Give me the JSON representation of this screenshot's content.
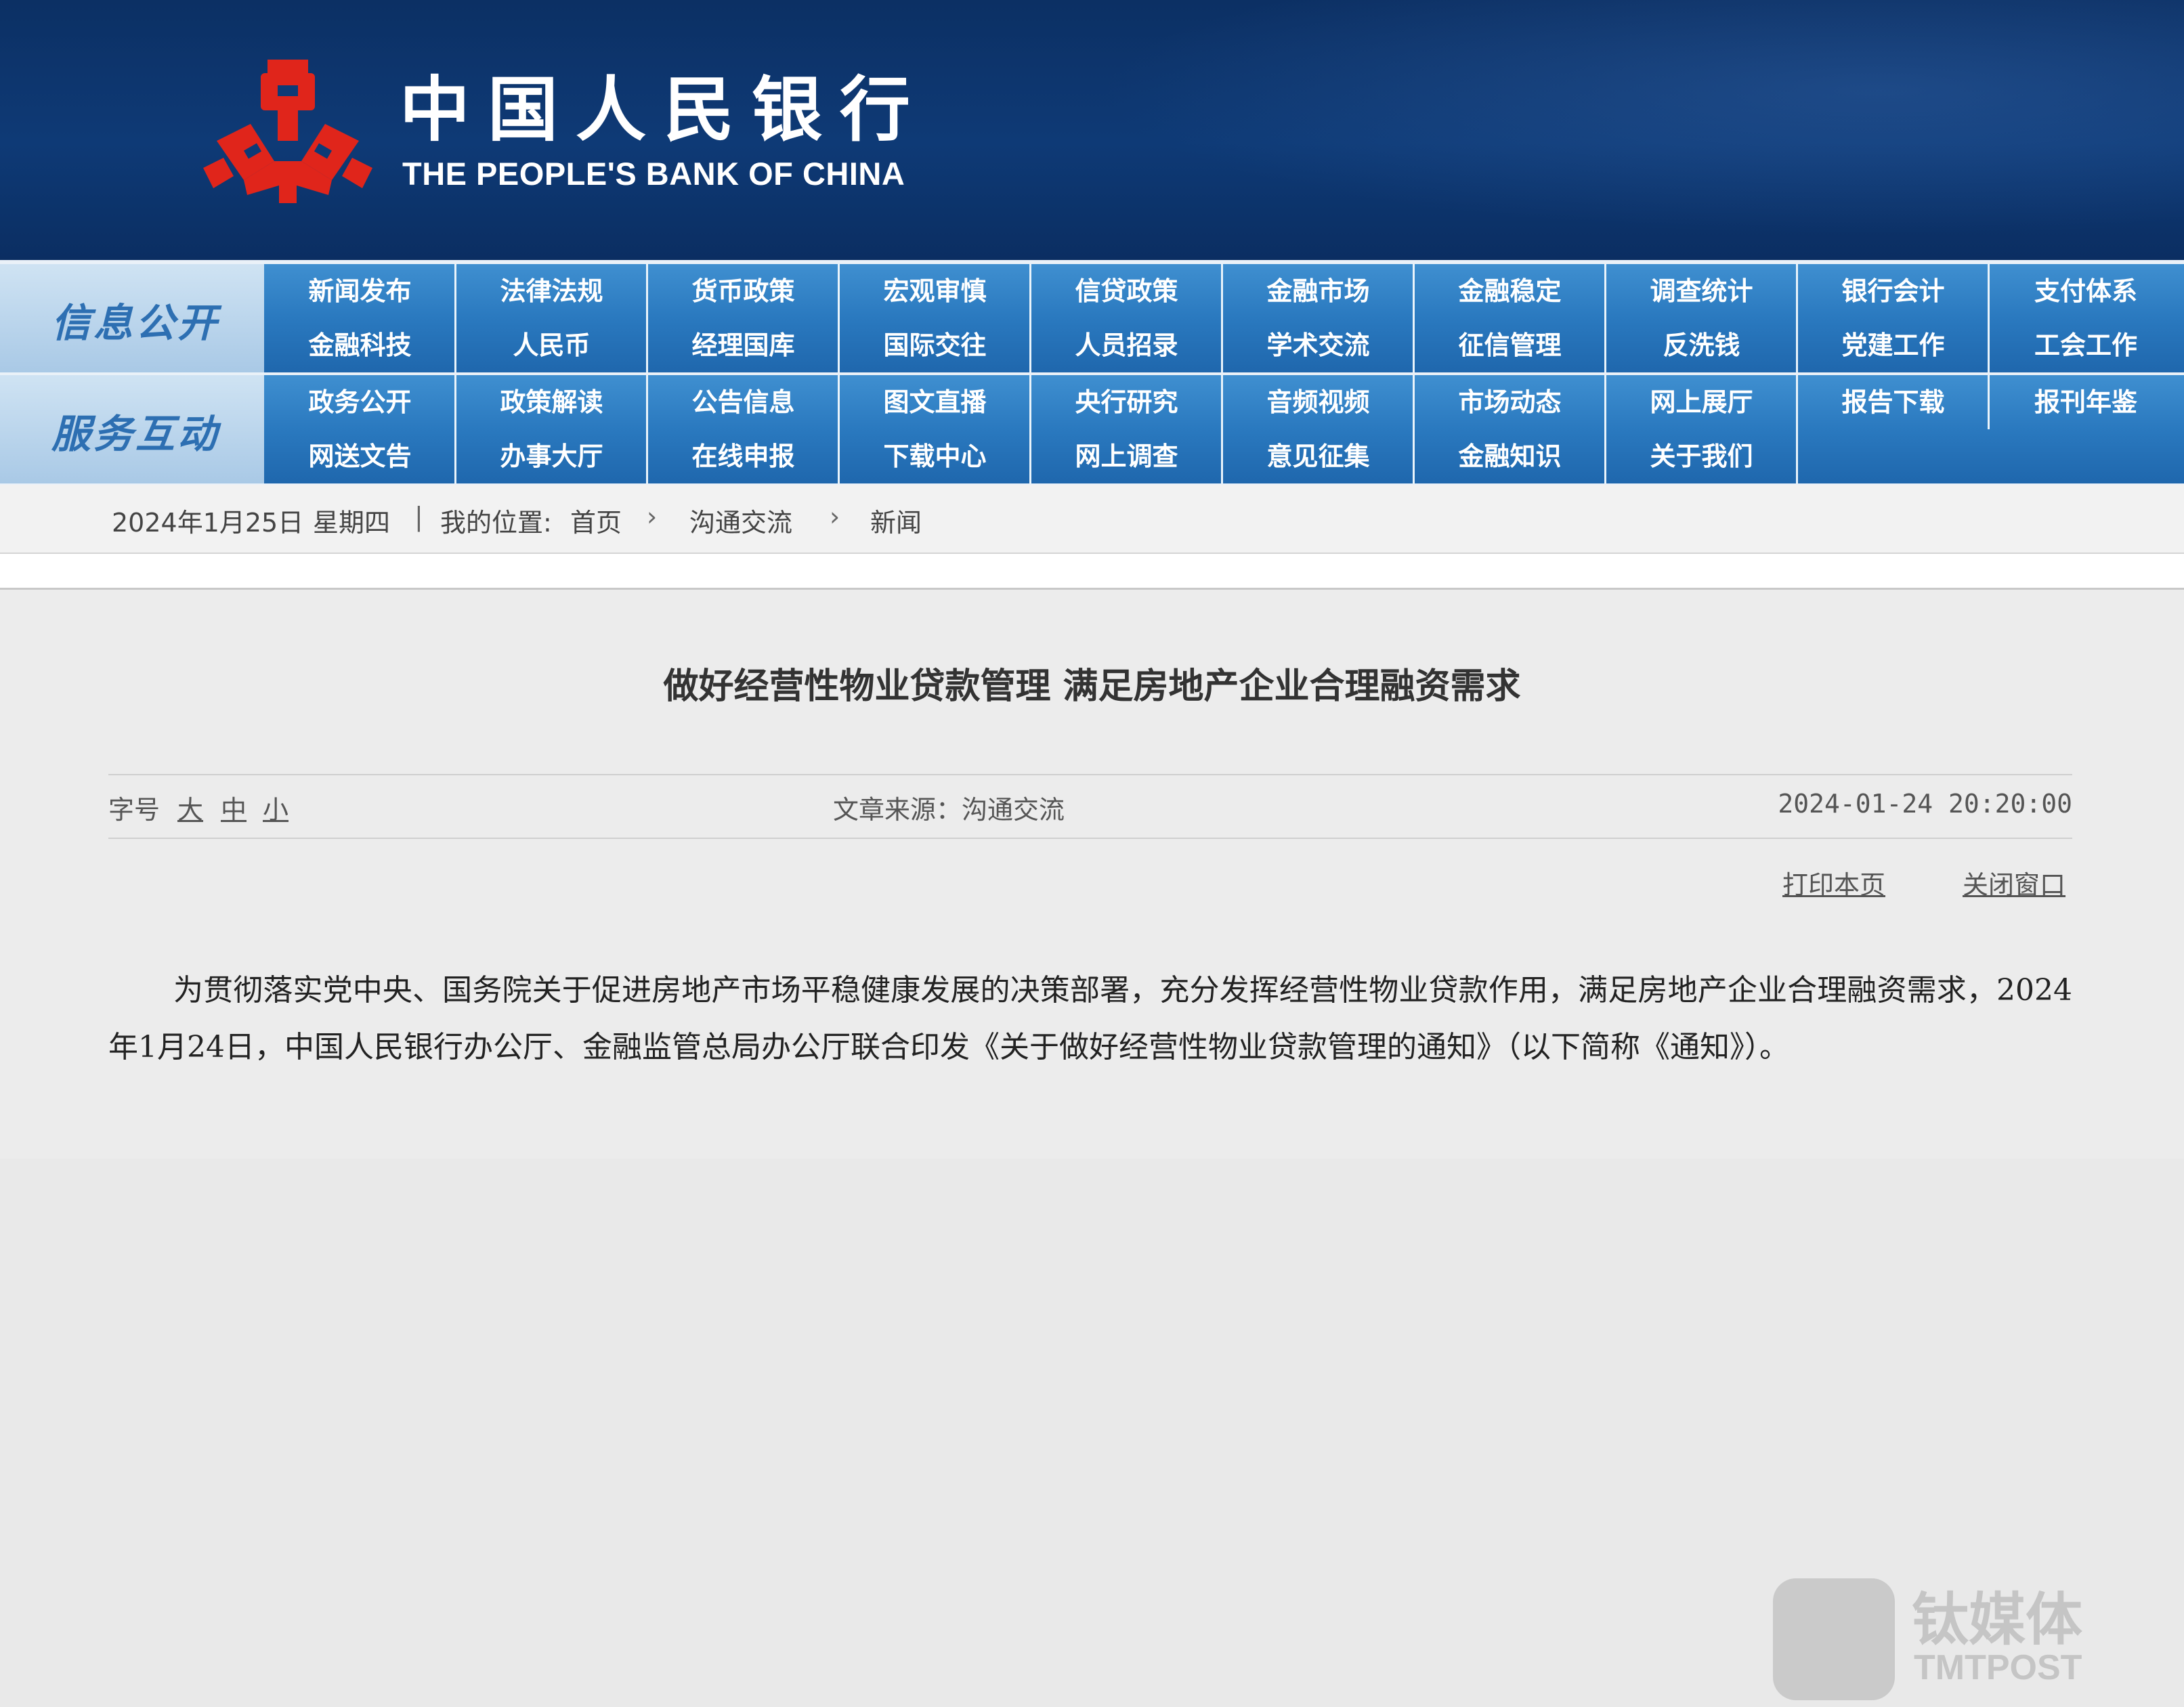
{
  "header": {
    "logo_cn": "中国人民银行",
    "logo_en": "THE PEOPLE'S BANK OF CHINA",
    "logo_icon": "pboc-emblem-icon",
    "bg_color": "#0e3a76",
    "emblem_color": "#e0251b"
  },
  "nav": {
    "band1_label": "信息公开",
    "band2_label": "服务互动",
    "band1_items": [
      "新闻发布",
      "法律法规",
      "货币政策",
      "宏观审慎",
      "信贷政策",
      "金融市场",
      "金融稳定",
      "调查统计",
      "银行会计",
      "支付体系",
      "金融科技",
      "人民币",
      "经理国库",
      "国际交往",
      "人员招录",
      "学术交流",
      "征信管理",
      "反洗钱",
      "党建工作",
      "工会工作"
    ],
    "band2_items": [
      "政务公开",
      "政策解读",
      "公告信息",
      "图文直播",
      "央行研究",
      "音频视频",
      "市场动态",
      "网上展厅",
      "报告下载",
      "报刊年鉴",
      "网送文告",
      "办事大厅",
      "在线申报",
      "下载中心",
      "网上调查",
      "意见征集",
      "金融知识",
      "关于我们"
    ]
  },
  "breadcrumb": {
    "date": "2024年1月25日",
    "weekday": "星期四",
    "divider": "|",
    "location_label": "我的位置:",
    "home": "首页",
    "section": "沟通交流",
    "page": "新闻",
    "arrow": "›"
  },
  "article": {
    "title": "做好经营性物业贷款管理 满足房地产企业合理融资需求",
    "font_size_label": "字号",
    "font_sizes": [
      "大",
      "中",
      "小"
    ],
    "source": "文章来源：沟通交流",
    "datetime": "2024-01-24 20:20:00",
    "print_link": "打印本页",
    "close_link": "关闭窗口",
    "body": "为贯彻落实党中央、国务院关于促进房地产市场平稳健康发展的决策部署，充分发挥经营性物业贷款作用，满足房地产企业合理融资需求，2024年1月24日，中国人民银行办公厅、金融监管总局办公厅联合印发《关于做好经营性物业贷款管理的通知》（以下简称《通知》）。"
  },
  "watermark": {
    "cn": "钛媒体",
    "en": "TMTPOST"
  }
}
